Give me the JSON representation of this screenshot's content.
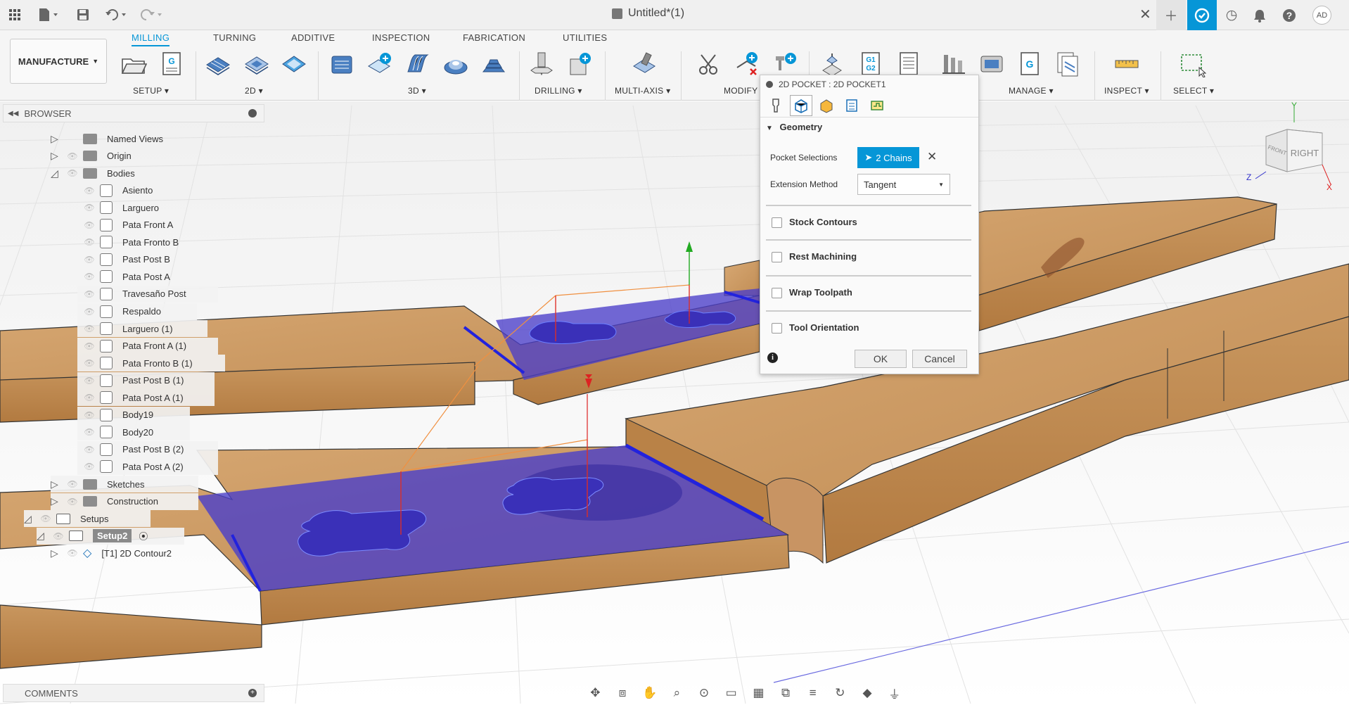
{
  "title_bar": {
    "document_title": "Untitled*(1)",
    "user_initials": "AD"
  },
  "ribbon": {
    "workspace_label": "MANUFACTURE",
    "tabs": [
      "MILLING",
      "TURNING",
      "ADDITIVE",
      "INSPECTION",
      "FABRICATION",
      "UTILITIES"
    ],
    "active_tab": "MILLING",
    "groups": [
      "SETUP",
      "2D",
      "3D",
      "DRILLING",
      "MULTI-AXIS",
      "MODIFY",
      "MANAGE",
      "INSPECT",
      "SELECT"
    ]
  },
  "browser": {
    "header": "BROWSER",
    "items": [
      {
        "label": "Named Views"
      },
      {
        "label": "Origin"
      },
      {
        "label": "Bodies"
      },
      {
        "label": "Asiento"
      },
      {
        "label": "Larguero"
      },
      {
        "label": "Pata Front A"
      },
      {
        "label": "Pata Fronto B"
      },
      {
        "label": "Past Post B"
      },
      {
        "label": "Pata Post A"
      },
      {
        "label": "Travesaño Post"
      },
      {
        "label": "Respaldo"
      },
      {
        "label": "Larguero (1)"
      },
      {
        "label": "Pata Front A (1)"
      },
      {
        "label": "Pata Fronto B (1)"
      },
      {
        "label": "Past Post B (1)"
      },
      {
        "label": "Pata Post A (1)"
      },
      {
        "label": "Body19"
      },
      {
        "label": "Body20"
      },
      {
        "label": "Past Post B (2)"
      },
      {
        "label": "Pata Post A (2)"
      },
      {
        "label": "Sketches"
      },
      {
        "label": "Construction"
      },
      {
        "label": "Setups"
      },
      {
        "label": "Setup2"
      },
      {
        "label": "[T1] 2D Contour2"
      }
    ]
  },
  "comments": {
    "label": "COMMENTS"
  },
  "dialog": {
    "title": "2D POCKET : 2D POCKET1",
    "geometry_section": "Geometry",
    "pocket_selections_label": "Pocket Selections",
    "pocket_selections_value": "2 Chains",
    "extension_method_label": "Extension Method",
    "extension_method_value": "Tangent",
    "options": [
      "Stock Contours",
      "Rest Machining",
      "Wrap Toolpath",
      "Tool Orientation"
    ],
    "ok_label": "OK",
    "cancel_label": "Cancel"
  },
  "viewcube": {
    "face_label": "RIGHT",
    "front_label": "FRONT",
    "axes": [
      "Y",
      "Z",
      "X"
    ]
  },
  "colors": {
    "accent": "#0696d7",
    "pocket": "#4a3ec9",
    "wood": "#c7955c"
  }
}
